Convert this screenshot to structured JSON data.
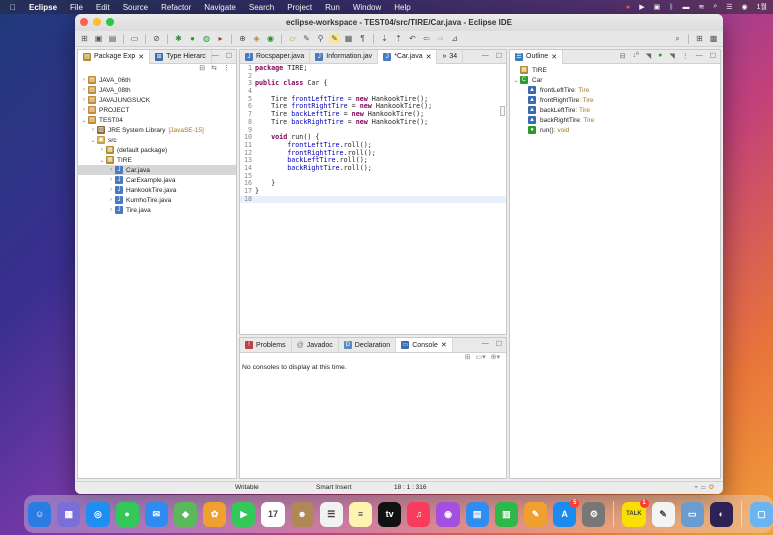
{
  "menubar": {
    "items": [
      "Eclipse",
      "File",
      "Edit",
      "Source",
      "Refactor",
      "Navigate",
      "Search",
      "Project",
      "Run",
      "Window",
      "Help"
    ],
    "clock": "1월"
  },
  "window": {
    "title": "eclipse-workspace - TEST04/src/TIRE/Car.java - Eclipse IDE"
  },
  "package_explorer": {
    "tabs": [
      "Package Exp",
      "Type Hierarc"
    ],
    "tree": [
      {
        "label": "JAVA_06th",
        "indent": 0,
        "arrow": ">",
        "icon": "project"
      },
      {
        "label": "JAVA_08th",
        "indent": 0,
        "arrow": ">",
        "icon": "project"
      },
      {
        "label": "JAVAJUNGSUCK",
        "indent": 0,
        "arrow": ">",
        "icon": "project"
      },
      {
        "label": "PROJECT",
        "indent": 0,
        "arrow": ">",
        "icon": "project"
      },
      {
        "label": "TEST04",
        "indent": 0,
        "arrow": "v",
        "icon": "project"
      },
      {
        "label": "JRE System Library",
        "extra": "[JavaSE-15]",
        "indent": 1,
        "arrow": ">",
        "icon": "library"
      },
      {
        "label": "src",
        "indent": 1,
        "arrow": "v",
        "icon": "folder"
      },
      {
        "label": "(default package)",
        "indent": 2,
        "arrow": ">",
        "icon": "package"
      },
      {
        "label": "TIRE",
        "indent": 2,
        "arrow": "v",
        "icon": "package"
      },
      {
        "label": "Car.java",
        "indent": 3,
        "arrow": ">",
        "icon": "java",
        "selected": true
      },
      {
        "label": "CarExample.java",
        "indent": 3,
        "arrow": ">",
        "icon": "java"
      },
      {
        "label": "HankookTire.java",
        "indent": 3,
        "arrow": ">",
        "icon": "java"
      },
      {
        "label": "KumhoTire.java",
        "indent": 3,
        "arrow": ">",
        "icon": "java"
      },
      {
        "label": "Tire.java",
        "indent": 3,
        "arrow": ">",
        "icon": "java"
      }
    ]
  },
  "editor": {
    "tabs": [
      "Rocspaper.java",
      "Information.jav",
      "*Car.java",
      "34"
    ],
    "lines": [
      {
        "n": "1",
        "text": "package TIRE;"
      },
      {
        "n": "2",
        "text": ""
      },
      {
        "n": "3",
        "text": "public class Car {"
      },
      {
        "n": "4",
        "text": ""
      },
      {
        "n": "5",
        "text": "    Tire frontLeftTire = new HankookTire();"
      },
      {
        "n": "6",
        "text": "    Tire frontRightTire = new HankookTire();"
      },
      {
        "n": "7",
        "text": "    Tire backLeftTire = new HankookTire();"
      },
      {
        "n": "8",
        "text": "    Tire backRightTire = new HankookTire();"
      },
      {
        "n": "9",
        "text": ""
      },
      {
        "n": "10",
        "text": "    void run() {"
      },
      {
        "n": "11",
        "text": "        frontLeftTire.roll();"
      },
      {
        "n": "12",
        "text": "        frontRightTire.roll();"
      },
      {
        "n": "13",
        "text": "        backLeftTire.roll();"
      },
      {
        "n": "14",
        "text": "        backRightTire.roll();"
      },
      {
        "n": "15",
        "text": ""
      },
      {
        "n": "16",
        "text": "    }"
      },
      {
        "n": "17",
        "text": "}"
      },
      {
        "n": "18",
        "text": ""
      }
    ]
  },
  "outline": {
    "tab": "Outline",
    "items": [
      {
        "label": "TIRE",
        "type": "",
        "indent": 0,
        "icon": "package"
      },
      {
        "label": "Car",
        "type": "",
        "indent": 0,
        "icon": "class"
      },
      {
        "label": "frontLeftTire",
        "type": " : Tire",
        "indent": 1,
        "icon": "field"
      },
      {
        "label": "frontRightTire",
        "type": " : Tire",
        "indent": 1,
        "icon": "field"
      },
      {
        "label": "backLeftTire",
        "type": " : Tire",
        "indent": 1,
        "icon": "field"
      },
      {
        "label": "backRightTire",
        "type": " : Tire",
        "indent": 1,
        "icon": "field"
      },
      {
        "label": "run()",
        "type": " : void",
        "indent": 1,
        "icon": "method"
      }
    ]
  },
  "console": {
    "tabs": [
      "Problems",
      "Javadoc",
      "Declaration",
      "Console"
    ],
    "message": "No consoles to display at this time."
  },
  "statusbar": {
    "mode": "Writable",
    "insert": "Smart Insert",
    "position": "18 : 1 : 316"
  },
  "dock": {
    "apps": [
      {
        "name": "finder-icon",
        "color": "#2a7be4",
        "glyph": "☺"
      },
      {
        "name": "launchpad-icon",
        "color": "#7a6fd9",
        "glyph": "▦"
      },
      {
        "name": "safari-icon",
        "color": "#1e8ef0",
        "glyph": "◎"
      },
      {
        "name": "messages-icon",
        "color": "#34c759",
        "glyph": "●"
      },
      {
        "name": "mail-icon",
        "color": "#2e8cf0",
        "glyph": "✉"
      },
      {
        "name": "maps-icon",
        "color": "#5cb85c",
        "glyph": "◆"
      },
      {
        "name": "photos-icon",
        "color": "#f0a030",
        "glyph": "✿"
      },
      {
        "name": "facetime-icon",
        "color": "#34c759",
        "glyph": "▶"
      },
      {
        "name": "calendar-icon",
        "color": "#ffffff",
        "glyph": "17"
      },
      {
        "name": "contacts-icon",
        "color": "#b08858",
        "glyph": "☻"
      },
      {
        "name": "reminders-icon",
        "color": "#f2f2f2",
        "glyph": "☰"
      },
      {
        "name": "notes-icon",
        "color": "#fff3b0",
        "glyph": "≡"
      },
      {
        "name": "appletv-icon",
        "color": "#111111",
        "glyph": "tv"
      },
      {
        "name": "music-icon",
        "color": "#fa3c5c",
        "glyph": "♫"
      },
      {
        "name": "podcasts-icon",
        "color": "#a54fe0",
        "glyph": "◉"
      },
      {
        "name": "keynote-icon",
        "color": "#2f8cf0",
        "glyph": "▤"
      },
      {
        "name": "numbers-icon",
        "color": "#2fb84a",
        "glyph": "▥"
      },
      {
        "name": "pages-icon",
        "color": "#f0a030",
        "glyph": "✎"
      },
      {
        "name": "appstore-icon",
        "color": "#1a8cf0",
        "glyph": "A",
        "badge": "5"
      },
      {
        "name": "system-preferences-icon",
        "color": "#777777",
        "glyph": "⚙"
      },
      {
        "name": "kakaotalk-icon",
        "color": "#f9e000",
        "glyph": "TALK",
        "badge": "1"
      },
      {
        "name": "textedit-icon",
        "color": "#f4f4f4",
        "glyph": "✎"
      },
      {
        "name": "preview-icon",
        "color": "#6a9cd0",
        "glyph": "▭"
      },
      {
        "name": "eclipse-icon",
        "color": "#2c2255",
        "glyph": "◐"
      },
      {
        "name": "downloads-folder-icon",
        "color": "#6cb4f0",
        "glyph": "▢"
      }
    ]
  }
}
